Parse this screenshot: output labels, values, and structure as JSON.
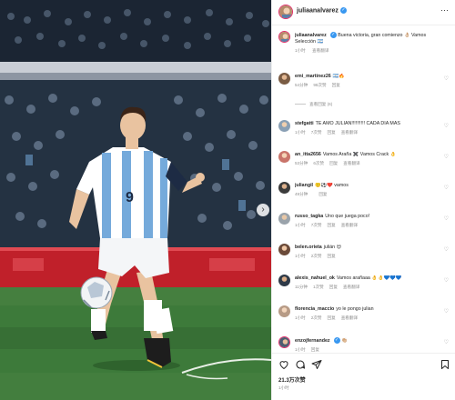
{
  "post": {
    "username": "juliaanalvarez",
    "more_icon": "more-horizontal-icon"
  },
  "caption": {
    "username": "juliaanalvarez",
    "text": "Buena victoria, gran comienzo 👌🏼 Vamos Selección 🇦🇷",
    "time": "1小时",
    "see_translation": "查看翻译"
  },
  "comments": [
    {
      "user": "emi_martinez26",
      "text": "🇦🇷🔥",
      "time": "54分钟",
      "likes": "98次赞",
      "reply": "回复",
      "translate": "",
      "heart": true
    },
    {
      "user": "stefgatti",
      "text": "TE AMO JULIAN!!!!!!!!!! CADA DÍA MÁS",
      "time": "1小时",
      "likes": "7次赞",
      "reply": "回复",
      "translate": "查看翻译",
      "heart": true
    },
    {
      "user": "an_itta2656",
      "text": "Vamos Araña ✖️ Vamos Crack 👌",
      "time": "53分钟",
      "likes": "6次赞",
      "reply": "回复",
      "translate": "查看翻译",
      "heart": true
    },
    {
      "user": "juliangil",
      "text": "🙂⚽❤️ vamos",
      "time": "49分钟",
      "likes": "",
      "reply": "回复",
      "translate": "",
      "heart": true
    },
    {
      "user": "russo_tagka",
      "text": "Uno que juega poco!",
      "time": "1小时",
      "likes": "7次赞",
      "reply": "回复",
      "translate": "查看翻译",
      "heart": true
    },
    {
      "user": "belen.orieta",
      "text": "julián 😍",
      "time": "1小时",
      "likes": "2次赞",
      "reply": "回复",
      "translate": "",
      "heart": true
    },
    {
      "user": "alexis_nahuel_ok",
      "text": "Vamos arañaaa 👌👌💙💙💙",
      "time": "11分钟",
      "likes": "1次赞",
      "reply": "回复",
      "translate": "查看翻译",
      "heart": true
    },
    {
      "user": "florencia_maccio",
      "text": "yo le pongo julian",
      "time": "1小时",
      "likes": "2次赞",
      "reply": "回复",
      "translate": "查看翻译",
      "heart": true
    },
    {
      "user": "enzojfernandez",
      "text": "👏🏼",
      "time": "1小时",
      "likes": "",
      "reply": "回复",
      "translate": "",
      "heart": true
    }
  ],
  "reply_toggle": "查看回复 (6)",
  "actions": {
    "like_icon": "heart-icon",
    "comment_icon": "comment-icon",
    "share_icon": "share-icon",
    "save_icon": "bookmark-icon"
  },
  "likes_count": "21.3万次赞",
  "posted_time": "1小时",
  "photo": {
    "jersey_number": "9",
    "nav_icon": "chevron-right-icon",
    "colors": {
      "pitch": "#3d7a3a",
      "jersey_blue": "#75aadb",
      "crowd": "#223040",
      "ad_board": "#c0202a"
    }
  }
}
